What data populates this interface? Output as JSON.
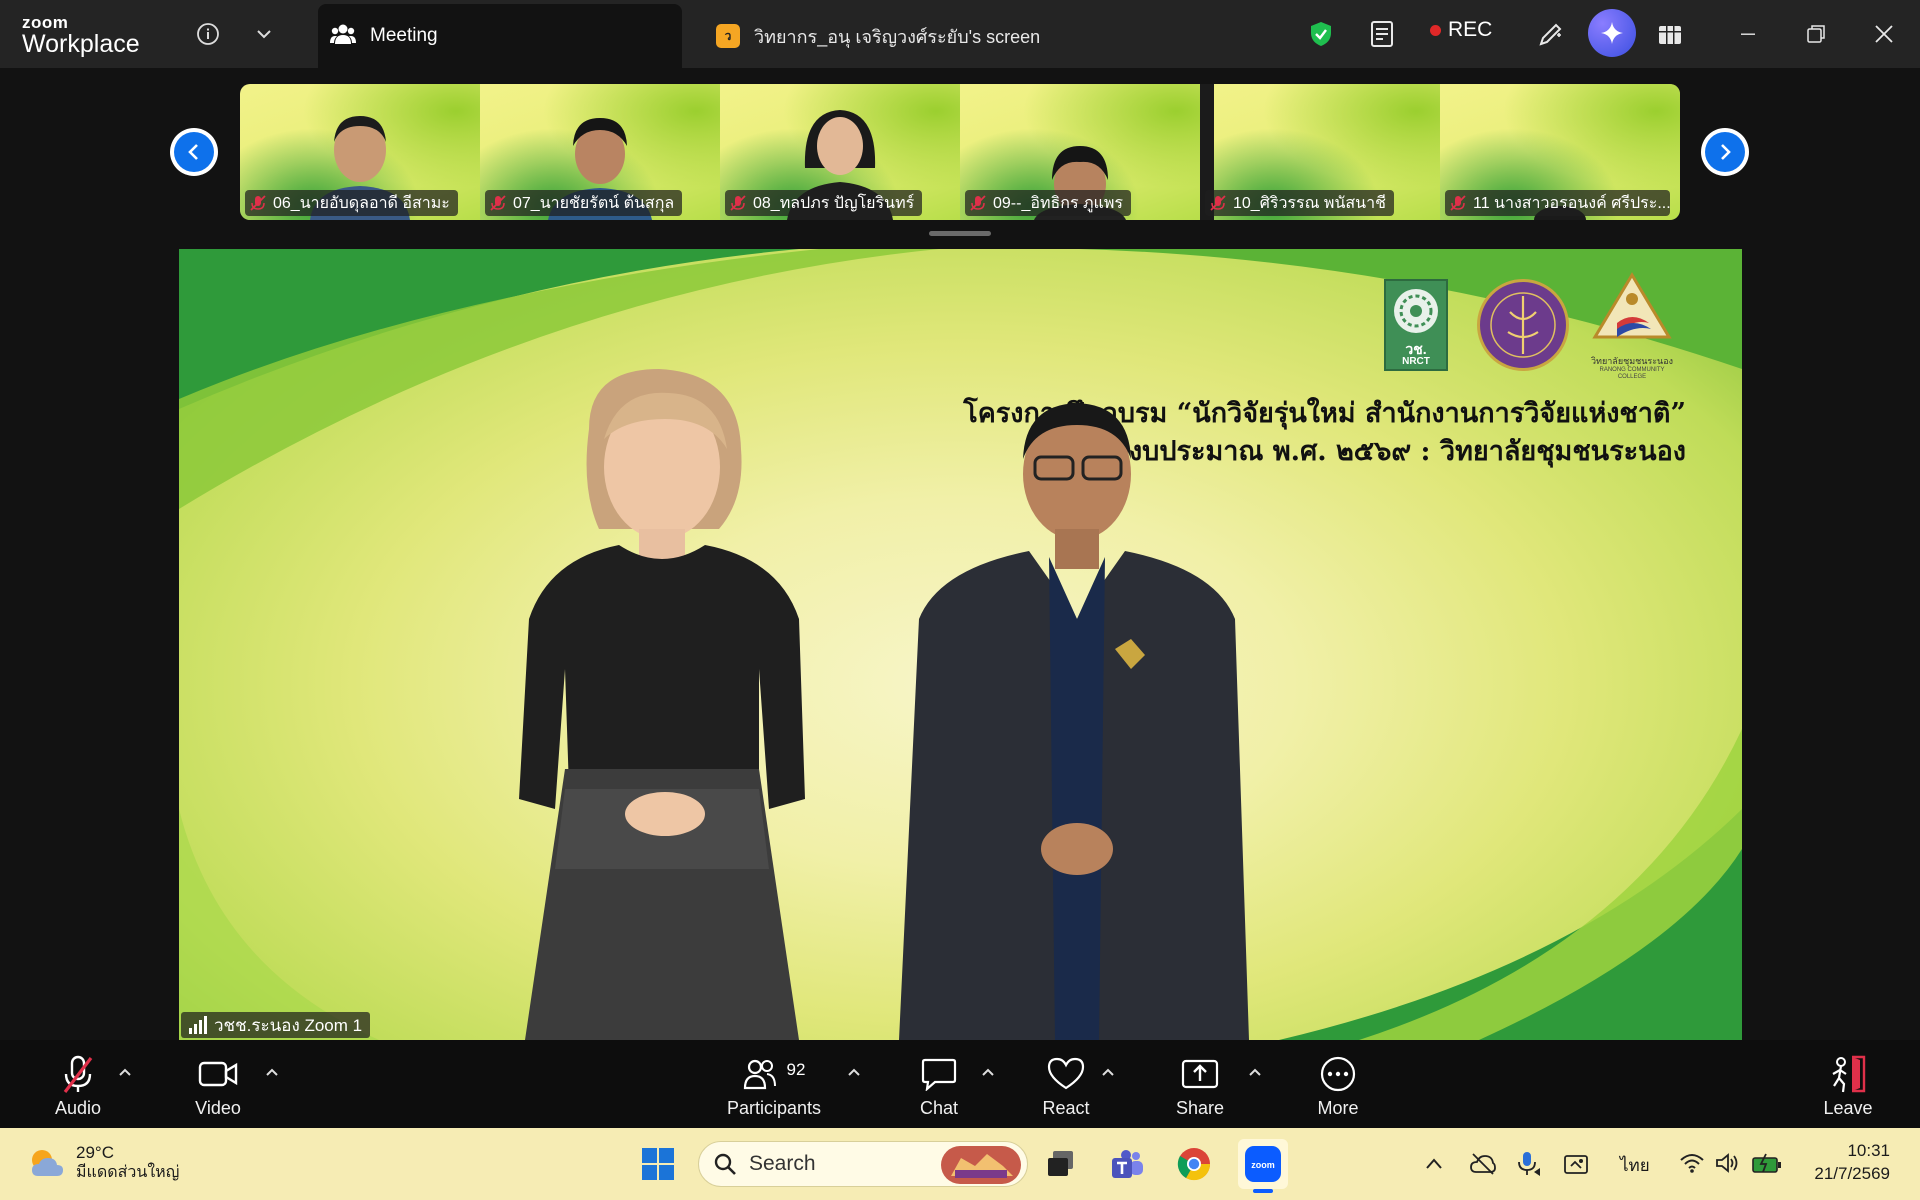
{
  "titlebar": {
    "brand_top": "zoom",
    "brand_bottom": "Workplace",
    "meeting_tab": "Meeting",
    "share_tab_badge": "ว",
    "share_tab": "วิทยากร_อนุ เจริญวงศ์ระยับ's screen",
    "rec_label": "REC"
  },
  "thumbnails": [
    {
      "name": "06_นายอับดุลอาดี อีสามะ"
    },
    {
      "name": "07_นายชัยรัตน์ ต้นสกุล"
    },
    {
      "name": "08_ทลปภร ปัญโยรินทร์"
    },
    {
      "name": "09--_อิทธิกร ภูแพร"
    },
    {
      "name": "10_ศิริวรรณ พนัสนาชี"
    },
    {
      "name": "11 นางสาวอรอนงค์ ศรีประ..."
    }
  ],
  "share": {
    "headline_1": "โครงการฝึกอบรม “นักวิจัยรุ่นใหม่ สำนักงานการวิจัยแห่งชาติ”",
    "headline_2": "ประจำปีงบประมาณ พ.ศ. ๒๕๖๙ : วิทยาลัยชุมชนระนอง",
    "logo_text": "วช.",
    "logo_sub": "NRCT",
    "college_text": "วิทยาลัยชุมชนระนอง",
    "college_sub": "RANONG COMMUNITY COLLEGE",
    "speaker_label": "วชช.ระนอง Zoom 1"
  },
  "toolbar": {
    "audio": "Audio",
    "video": "Video",
    "participants": "Participants",
    "participants_count": "92",
    "chat": "Chat",
    "react": "React",
    "share": "Share",
    "more": "More",
    "leave": "Leave"
  },
  "taskbar": {
    "temp": "29°C",
    "weather_desc": "มีแดดส่วนใหญ่",
    "search_placeholder": "Search",
    "language": "ไทย",
    "time": "10:31",
    "date": "21/7/2569"
  },
  "colors": {
    "accent": "#0e71eb",
    "rec": "#e02828",
    "muted_red": "#e0304a",
    "taskbar": "#f6ecb4"
  }
}
